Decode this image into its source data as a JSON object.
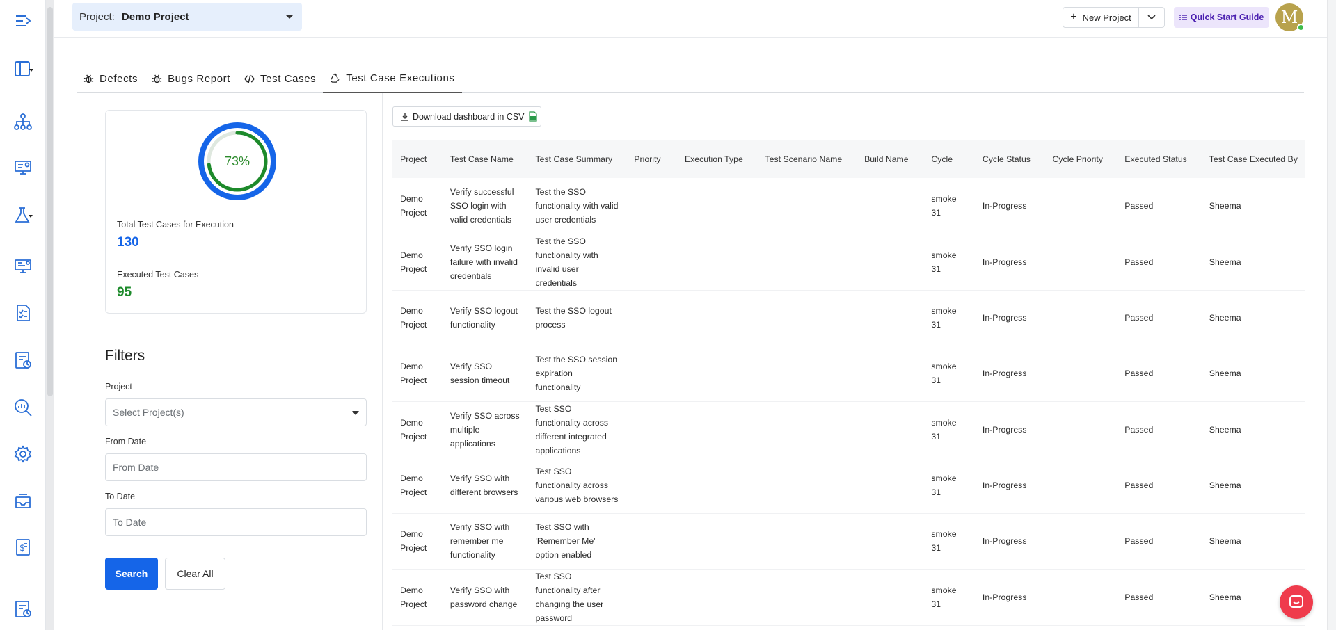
{
  "header": {
    "project_label": "Project:",
    "project_value": "Demo Project",
    "new_project_label": "New Project",
    "quick_start_label": "Quick Start Guide",
    "avatar_initial": "M"
  },
  "tabs": [
    {
      "label": "Defects",
      "icon": "bug-icon"
    },
    {
      "label": "Bugs Report",
      "icon": "bug-icon"
    },
    {
      "label": "Test Cases",
      "icon": "code-icon"
    },
    {
      "label": "Test Case Executions",
      "icon": "recycle-icon",
      "active": true
    }
  ],
  "stats": {
    "percent_label": "73%",
    "percent": 73,
    "total_label": "Total Test Cases for Execution",
    "total_value": "130",
    "executed_label": "Executed Test Cases",
    "executed_value": "95",
    "colors": {
      "outer": "#1565e8",
      "inner": "#1d8a2b",
      "total": "#1565e8",
      "executed": "#1d8a2b"
    }
  },
  "filters": {
    "title": "Filters",
    "project_label": "Project",
    "project_placeholder": "Select Project(s)",
    "from_label": "From Date",
    "from_placeholder": "From Date",
    "to_label": "To Date",
    "to_placeholder": "To Date",
    "search_label": "Search",
    "clear_label": "Clear All"
  },
  "download_label": "Download dashboard in CSV",
  "table": {
    "columns": [
      "Project",
      "Test Case Name",
      "Test Case Summary",
      "Priority",
      "Execution Type",
      "Test Scenario Name",
      "Build Name",
      "Cycle",
      "Cycle Status",
      "Cycle Priority",
      "Executed Status",
      "Test Case Executed By"
    ],
    "rows": [
      [
        "Demo Project",
        "Verify successful SSO login with valid credentials",
        "Test the SSO functionality with valid user credentials",
        "",
        "",
        "",
        "",
        "smoke 31",
        "In-Progress",
        "",
        "Passed",
        "Sheema"
      ],
      [
        "Demo Project",
        "Verify SSO login failure with invalid credentials",
        "Test the SSO functionality with invalid user credentials",
        "",
        "",
        "",
        "",
        "smoke 31",
        "In-Progress",
        "",
        "Passed",
        "Sheema"
      ],
      [
        "Demo Project",
        "Verify SSO logout functionality",
        "Test the SSO logout process",
        "",
        "",
        "",
        "",
        "smoke 31",
        "In-Progress",
        "",
        "Passed",
        "Sheema"
      ],
      [
        "Demo Project",
        "Verify SSO session timeout",
        "Test the SSO session expiration functionality",
        "",
        "",
        "",
        "",
        "smoke 31",
        "In-Progress",
        "",
        "Passed",
        "Sheema"
      ],
      [
        "Demo Project",
        "Verify SSO across multiple applications",
        "Test SSO functionality across different integrated applications",
        "",
        "",
        "",
        "",
        "smoke 31",
        "In-Progress",
        "",
        "Passed",
        "Sheema"
      ],
      [
        "Demo Project",
        "Verify SSO with different browsers",
        "Test SSO functionality across various web browsers",
        "",
        "",
        "",
        "",
        "smoke 31",
        "In-Progress",
        "",
        "Passed",
        "Sheema"
      ],
      [
        "Demo Project",
        "Verify SSO with remember me functionality",
        "Test SSO with 'Remember Me' option enabled",
        "",
        "",
        "",
        "",
        "smoke 31",
        "In-Progress",
        "",
        "Passed",
        "Sheema"
      ],
      [
        "Demo Project",
        "Verify SSO with password change",
        "Test SSO functionality after changing the user password",
        "",
        "",
        "",
        "",
        "smoke 31",
        "In-Progress",
        "",
        "Passed",
        "Sheema"
      ]
    ]
  },
  "sidebar": {
    "icons": [
      "menu-toggle-icon",
      "layout-icon",
      "hierarchy-icon",
      "monitor-settings-icon",
      "flask-icon",
      "monitor-code-icon",
      "checklist-icon",
      "report-clock-icon",
      "analytics-search-icon",
      "gear-icon",
      "inbox-icon",
      "billing-icon",
      "report-icon"
    ]
  }
}
